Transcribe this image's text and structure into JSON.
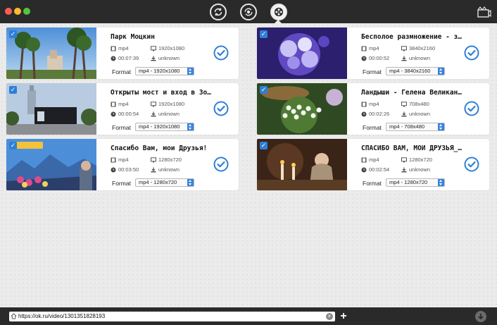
{
  "titlebar": {
    "buttons": [
      {
        "name": "convert-refresh-icon"
      },
      {
        "name": "convert-cycle-icon"
      },
      {
        "name": "film-reel-icon",
        "active": true
      }
    ],
    "right_icon": "film-clapper-icon"
  },
  "videos": [
    {
      "title": "Парк Моцкин",
      "container": "mp4",
      "resolution": "1920x1080",
      "duration": "00:07:39",
      "size": "unknown",
      "format_label": "Format",
      "format": "mp4 - 1920x1080",
      "checked": true,
      "thumb": "palms"
    },
    {
      "title": "Бесполое размножение - за...",
      "container": "mp4",
      "resolution": "3840x2160",
      "duration": "00:00:52",
      "size": "unknown",
      "format_label": "Format",
      "format": "mp4 - 3840x2160",
      "checked": true,
      "thumb": "coral"
    },
    {
      "title": "Открыты мост и вход в Зооп...",
      "container": "mp4",
      "resolution": "1920x1080",
      "duration": "00:00:54",
      "size": "unknown",
      "format_label": "Format",
      "format": "mp4 - 1920x1080",
      "checked": true,
      "thumb": "building"
    },
    {
      "title": "Ландыши - Гелена Великанов...",
      "container": "mp4",
      "resolution": "708x480",
      "duration": "00:02:26",
      "size": "unknown",
      "format_label": "Format",
      "format": "mp4 - 708x480",
      "checked": true,
      "thumb": "flowers"
    },
    {
      "title": "Спасибо Вам, мои Друзья!",
      "container": "mp4",
      "resolution": "1280x720",
      "duration": "00:03:50",
      "size": "unknown",
      "format_label": "Format",
      "format": "mp4 - 1280x720",
      "checked": true,
      "thumb": "mountains"
    },
    {
      "title": "СПАСИБО ВАМ, МОИ ДРУЗЬЯ_ К...",
      "container": "mp4",
      "resolution": "1280x720",
      "duration": "00:02:54",
      "size": "unknown",
      "format_label": "Format",
      "format": "mp4 - 1280x720",
      "checked": true,
      "thumb": "candle"
    }
  ],
  "bottombar": {
    "url": "https://ok.ru/video/1301351828193",
    "add_label": "+"
  },
  "colors": {
    "accent": "#2f7fd6",
    "titlebar": "#2a2a2a",
    "background": "#ebebeb"
  }
}
